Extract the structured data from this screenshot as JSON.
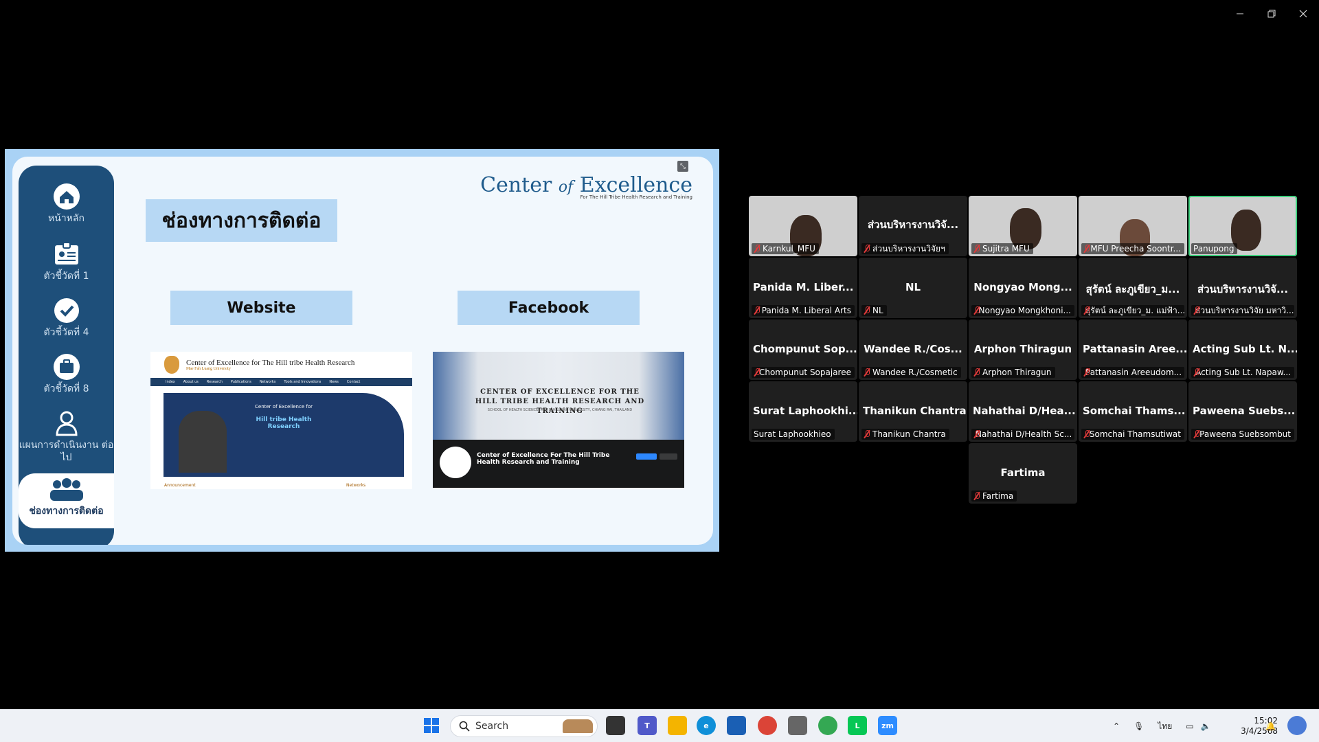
{
  "window": {
    "controls": [
      "minimize",
      "restore",
      "close"
    ]
  },
  "slide": {
    "title": "ช่องทางการติดต่อ",
    "brand_name_a": "Center",
    "brand_name_of": "of",
    "brand_name_b": "Excellence",
    "brand_sub": "For The Hill Tribe Health Research and Training",
    "sidebar": [
      {
        "label": "หน้าหลัก",
        "icon": "home-icon"
      },
      {
        "label": "ตัวชี้วัดที่ 1",
        "icon": "id-card-icon"
      },
      {
        "label": "ตัวชี้วัดที่ 4",
        "icon": "check-circle-icon"
      },
      {
        "label": "ตัวชี้วัดที่ 8",
        "icon": "briefcase-icon"
      },
      {
        "label": "แผนการดำเนินงาน ต่อไป",
        "icon": "person-icon"
      },
      {
        "label": "ช่องทางการติดต่อ",
        "icon": "group-icon"
      }
    ],
    "website_label": "Website",
    "facebook_label": "Facebook",
    "website_thumb": {
      "title": "Center of Excellence for The Hill tribe Health Research",
      "subtitle": "Mae Fah Luang University",
      "nav": [
        "Index",
        "About us",
        "Research",
        "Publications",
        "Networks",
        "Tools and Innovations",
        "News",
        "Contact"
      ],
      "hero_line1": "Center of Excellence for",
      "hero_line2": "Hill tribe Health Research",
      "footer_left": "Announcement",
      "footer_right": "Networks"
    },
    "facebook_thumb": {
      "heading": "CENTER OF EXCELLENCE FOR THE HILL TRIBE HEALTH RESEARCH AND TRAINING",
      "small": "SCHOOL OF HEALTH SCIENCE, MAE FAH LUANG UNIVERSITY, CHIANG RAI, THAILAND",
      "page_name": "Center of Excellence For The Hill Tribe Health Research and Training"
    }
  },
  "gallery": {
    "tiles": [
      {
        "name": "Karnkul_MFU",
        "video": true,
        "muted": true
      },
      {
        "name": "ส่วนบริหารงานวิจัยฯ",
        "big": "ส่วนบริหารงานวิจั...",
        "muted": true
      },
      {
        "name": "Sujitra MFU",
        "video": true,
        "muted": true
      },
      {
        "name": "MFU Preecha Soontr...",
        "video": true,
        "muted": true
      },
      {
        "name": "Panupong",
        "video": true,
        "muted": false,
        "active": true
      },
      {
        "name": "Panida M. Liberal Arts",
        "big": "Panida M. Liber...",
        "muted": true
      },
      {
        "name": "NL",
        "big": "NL",
        "muted": true
      },
      {
        "name": "Nongyao Mongkhoni...",
        "big": "Nongyao Mong...",
        "muted": true
      },
      {
        "name": "สุรัตน์ ละภูเขียว_ม. แม่ฟ้า...",
        "big": "สุรัตน์ ละภูเขียว_ม...",
        "muted": true
      },
      {
        "name": "ส่วนบริหารงานวิจัย มหาวิ...",
        "big": "ส่วนบริหารงานวิจั...",
        "muted": true
      },
      {
        "name": "Chompunut Sopajaree",
        "big": "Chompunut Sop...",
        "muted": true
      },
      {
        "name": "Wandee R./Cosmetic",
        "big": "Wandee R./Cos...",
        "muted": true
      },
      {
        "name": "Arphon Thiragun",
        "big": "Arphon Thiragun",
        "muted": true
      },
      {
        "name": "Pattanasin Areeudom...",
        "big": "Pattanasin Aree...",
        "muted": true
      },
      {
        "name": "Acting Sub Lt. Napaw...",
        "big": "Acting Sub Lt. N...",
        "muted": true
      },
      {
        "name": "Surat Laphookhieo",
        "big": "Surat Laphookhi...",
        "muted": false
      },
      {
        "name": "Thanikun Chantra",
        "big": "Thanikun Chantra",
        "muted": true
      },
      {
        "name": "Nahathai D/Health Sc...",
        "big": "Nahathai D/Hea...",
        "muted": true
      },
      {
        "name": "Somchai Thamsutiwat",
        "big": "Somchai Thams...",
        "muted": true
      },
      {
        "name": "Paweena Suebsombut",
        "big": "Paweena Suebs...",
        "muted": true
      },
      {
        "name": "Fartima",
        "big": "Fartima",
        "muted": true
      }
    ]
  },
  "taskbar": {
    "search_placeholder": "Search",
    "lang": "ไทย",
    "time": "15:02",
    "date": "3/4/2568"
  }
}
